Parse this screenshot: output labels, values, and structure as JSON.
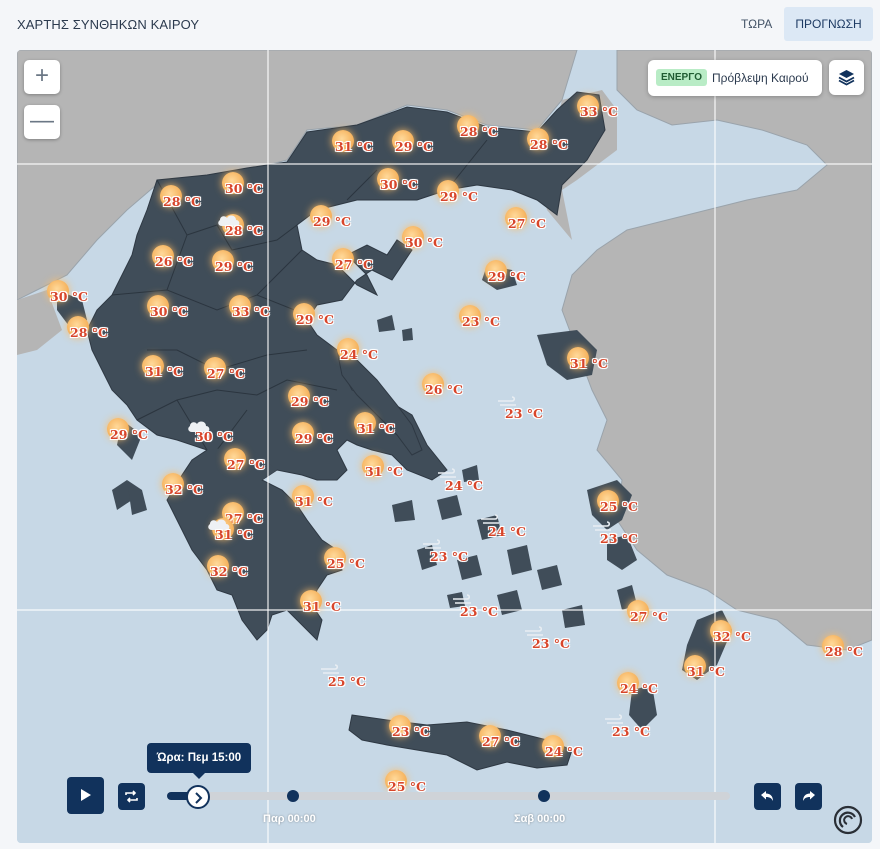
{
  "header": {
    "title": "ΧΑΡΤΗΣ ΣΥΝΘΗΚΩΝ ΚΑΙΡΟΥ",
    "tabs": [
      {
        "label": "ΤΩΡΑ",
        "active": false
      },
      {
        "label": "ΠΡΟΓΝΩΣΗ",
        "active": true
      }
    ]
  },
  "map_controls": {
    "zoom_in": "+",
    "zoom_out": "—",
    "status_badge": "ΕΝΕΡΓΟ",
    "status_text": "Πρόβλεψη Καιρού",
    "layers_icon": "layers-icon"
  },
  "markers": [
    {
      "temp": "33 °C",
      "icon": "sun"
    },
    {
      "temp": "31 °C",
      "icon": "sun"
    },
    {
      "temp": "29 °C",
      "icon": "sun"
    },
    {
      "temp": "28 °C",
      "icon": "sun"
    },
    {
      "temp": "28 °C",
      "icon": "sun"
    },
    {
      "temp": "30 °C",
      "icon": "sun"
    },
    {
      "temp": "28 °C",
      "icon": "sun"
    },
    {
      "temp": "30 °C",
      "icon": "sun"
    },
    {
      "temp": "29 °C",
      "icon": "sun"
    },
    {
      "temp": "28 °C",
      "icon": "cloud-sun"
    },
    {
      "temp": "29 °C",
      "icon": "sun"
    },
    {
      "temp": "27 °C",
      "icon": "sun"
    },
    {
      "temp": "30 °C",
      "icon": "sun"
    },
    {
      "temp": "26 °C",
      "icon": "sun"
    },
    {
      "temp": "29 °C",
      "icon": "sun"
    },
    {
      "temp": "27 °C",
      "icon": "sun"
    },
    {
      "temp": "29 °C",
      "icon": "sun"
    },
    {
      "temp": "30 °C",
      "icon": "sun"
    },
    {
      "temp": "30 °C",
      "icon": "sun"
    },
    {
      "temp": "33 °C",
      "icon": "sun"
    },
    {
      "temp": "29 °C",
      "icon": "sun"
    },
    {
      "temp": "23 °C",
      "icon": "sun"
    },
    {
      "temp": "28 °C",
      "icon": "sun"
    },
    {
      "temp": "24 °C",
      "icon": "sun"
    },
    {
      "temp": "31 °C",
      "icon": "sun"
    },
    {
      "temp": "31 °C",
      "icon": "sun"
    },
    {
      "temp": "27 °C",
      "icon": "sun"
    },
    {
      "temp": "26 °C",
      "icon": "sun"
    },
    {
      "temp": "29 °C",
      "icon": "sun"
    },
    {
      "temp": "23 °C",
      "icon": "wind"
    },
    {
      "temp": "29 °C",
      "icon": "sun"
    },
    {
      "temp": "30 °C",
      "icon": "cloud"
    },
    {
      "temp": "29 °C",
      "icon": "sun"
    },
    {
      "temp": "31 °C",
      "icon": "sun"
    },
    {
      "temp": "27 °C",
      "icon": "sun"
    },
    {
      "temp": "31 °C",
      "icon": "sun"
    },
    {
      "temp": "24 °C",
      "icon": "wind"
    },
    {
      "temp": "32 °C",
      "icon": "sun"
    },
    {
      "temp": "31 °C",
      "icon": "sun"
    },
    {
      "temp": "27 °C",
      "icon": "sun"
    },
    {
      "temp": "31 °C",
      "icon": "cloud-sun"
    },
    {
      "temp": "24 °C",
      "icon": "wind"
    },
    {
      "temp": "25 °C",
      "icon": "sun"
    },
    {
      "temp": "25 °C",
      "icon": "sun"
    },
    {
      "temp": "23 °C",
      "icon": "wind"
    },
    {
      "temp": "32 °C",
      "icon": "sun"
    },
    {
      "temp": "23 °C",
      "icon": "wind"
    },
    {
      "temp": "31 °C",
      "icon": "sun"
    },
    {
      "temp": "23 °C",
      "icon": "wind"
    },
    {
      "temp": "27 °C",
      "icon": "sun"
    },
    {
      "temp": "32 °C",
      "icon": "sun"
    },
    {
      "temp": "23 °C",
      "icon": "wind"
    },
    {
      "temp": "31 °C",
      "icon": "sun"
    },
    {
      "temp": "28 °C",
      "icon": "sun"
    },
    {
      "temp": "25 °C",
      "icon": "wind"
    },
    {
      "temp": "24 °C",
      "icon": "sun"
    },
    {
      "temp": "23 °C",
      "icon": "sun"
    },
    {
      "temp": "27 °C",
      "icon": "sun"
    },
    {
      "temp": "24 °C",
      "icon": "sun"
    },
    {
      "temp": "23 °C",
      "icon": "wind"
    },
    {
      "temp": "25 °C",
      "icon": "sun"
    }
  ],
  "timeline": {
    "tooltip": "Ώρα: Πεμ 15:00",
    "ticks": [
      {
        "label": "Παρ 00:00"
      },
      {
        "label": "Σαβ 00:00"
      }
    ],
    "play_icon": "play-icon",
    "loop_icon": "loop-icon",
    "prev_icon": "undo-icon",
    "next_icon": "redo-icon"
  },
  "colors": {
    "land_greece": "#404d59",
    "land_neighbor": "#b5b5b5",
    "sea": "#c7d8e6",
    "accent": "#11325c",
    "temp_text": "#d8452a"
  }
}
